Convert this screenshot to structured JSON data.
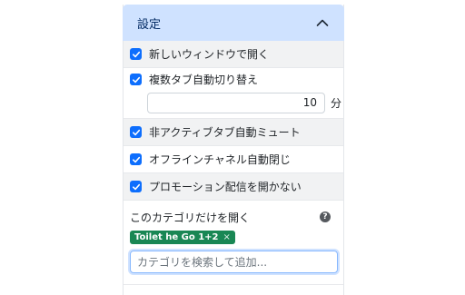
{
  "panel": {
    "title": "設定",
    "toggle_icon": "chevron-up-icon"
  },
  "options": {
    "new_window": {
      "label": "新しいウィンドウで開く",
      "checked": true
    },
    "auto_switch": {
      "label": "複数タブ自動切り替え",
      "checked": true,
      "value": "10",
      "unit": "分"
    },
    "auto_mute": {
      "label": "非アクティブタブ自動ミュート",
      "checked": true
    },
    "auto_close_offline": {
      "label": "オフラインチャネル自動閉じ",
      "checked": true
    },
    "no_promo": {
      "label": "プロモーション配信を開かない",
      "checked": true
    }
  },
  "category": {
    "label": "このカテゴリだけを開く",
    "help_icon": "question-circle-icon",
    "help_text": "?",
    "tags": [
      {
        "label": "Toilet he Go 1+2",
        "remove": "×"
      }
    ],
    "search_placeholder": "カテゴリを検索して追加..."
  },
  "colors": {
    "header_bg": "#cfe2ff",
    "checkbox": "#0d6efd",
    "tag_bg": "#198754"
  }
}
